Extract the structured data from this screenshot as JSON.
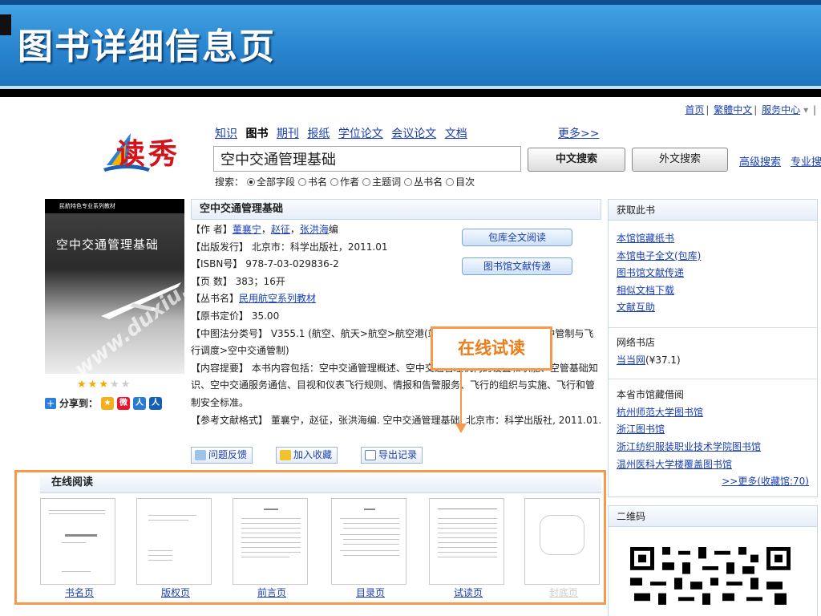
{
  "slide": {
    "title": "图书详细信息页"
  },
  "toplinks": [
    "首页",
    "繁體中文",
    "服务中心"
  ],
  "logo": {
    "text": "读秀"
  },
  "nav": {
    "tabs": [
      "知识",
      "图书",
      "期刊",
      "报纸",
      "学位论文",
      "会议论文",
      "文档"
    ],
    "more": "更多>>"
  },
  "search": {
    "value": "空中交通管理基础",
    "cn_button": "中文搜索",
    "en_button": "外文搜索",
    "advanced": "高级搜索",
    "pro": "专业搜索",
    "label": "搜索：",
    "options": [
      "全部字段",
      "书名",
      "作者",
      "主题词",
      "丛书名",
      "目次"
    ]
  },
  "cover": {
    "series": "民航特色专业系列教材",
    "title": "空中交通管理基础",
    "watermark": "www.duxiu.com"
  },
  "rating": {
    "filled": 3,
    "total": 5
  },
  "share": {
    "label": "分享到："
  },
  "book": {
    "title": "空中交通管理基础",
    "author_label": "【作 者】",
    "authors": [
      "董襄宁",
      "赵征",
      "张洪海"
    ],
    "author_suffix": "编",
    "publisher_label": "【出版发行】",
    "publisher": "北京市：科学出版社，2011.01",
    "isbn_label": "【ISBN号】",
    "isbn": "978-7-03-029836-2",
    "pages_label": "【页 数】",
    "pages": "383；16开",
    "series_label": "【丛书名】",
    "series": "民用航空系列教材",
    "price_label": "【原书定价】",
    "price": "35.00",
    "clc_label": "【中图法分类号】",
    "clc": "V355.1 (航空、航天>航空>航空港(站)、机场及其技术管理>空中管制与飞行调度>空中交通管制)",
    "summary_label": "【内容提要】",
    "summary": "本书内容包括：空中交通管理概述、空中交通管理机构的设置和职能、空管基础知识、空中交通服务通信、目视和仪表飞行规则、情报和告警服务、飞行的组织与实施、飞行和管制安全标准。",
    "cite_label": "【参考文献格式】",
    "cite": "董襄宁，赵征，张洪海编. 空中交通管理基础. 北京市：科学出版社, 2011.01."
  },
  "actions": {
    "read": "包库全文阅读",
    "deliver": "图书馆文献传递"
  },
  "tools": [
    "问题反馈",
    "加入收藏",
    "导出记录"
  ],
  "callout": "在线试读",
  "sidebar": {
    "get_title": "获取此书",
    "get_links": [
      "本馆馆藏纸书",
      "本馆电子全文(包库)",
      "图书馆文献传递",
      "相似文档下载",
      "文献互助"
    ],
    "store_title": "网络书店",
    "store_link": "当当网",
    "store_price": "(¥37.1)",
    "lib_title": "本省市馆藏借阅",
    "lib_links": [
      "杭州师范大学图书馆",
      "浙江图书馆",
      "浙江纺织服装职业技术学院图书馆",
      "温州医科大学楼覆盖图书馆"
    ],
    "lib_more": ">>更多(收藏馆:70)",
    "qr_title": "二维码"
  },
  "reading": {
    "title": "在线阅读",
    "pages": [
      "书名页",
      "版权页",
      "前言页",
      "目录页",
      "试读页",
      "封底页"
    ]
  }
}
